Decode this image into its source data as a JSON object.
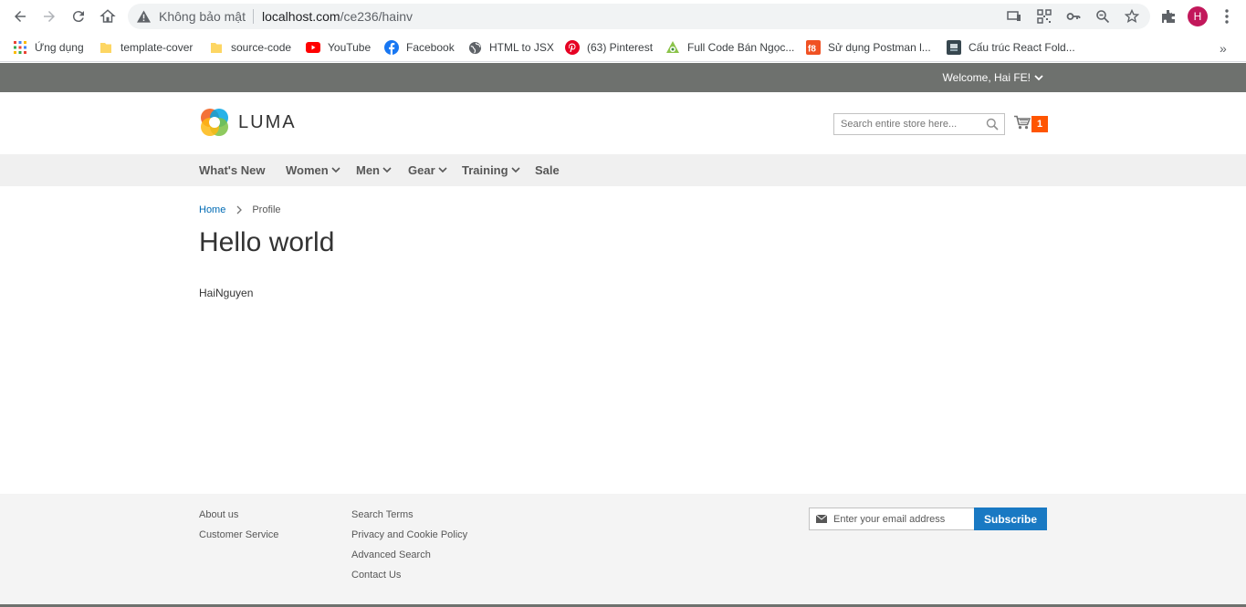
{
  "browser": {
    "security_label": "Không bảo mật",
    "url_host": "localhost.com",
    "url_path": "/ce236/hainv",
    "profile_initial": "H",
    "bookmarks": [
      {
        "label": "Ứng dụng",
        "icon": "apps-grid-icon"
      },
      {
        "label": "template-cover",
        "icon": "folder-icon"
      },
      {
        "label": "source-code",
        "icon": "folder-icon"
      },
      {
        "label": "YouTube",
        "icon": "youtube-icon"
      },
      {
        "label": "Facebook",
        "icon": "facebook-icon"
      },
      {
        "label": "HTML to JSX",
        "icon": "globe-icon"
      },
      {
        "label": "(63) Pinterest",
        "icon": "pinterest-icon"
      },
      {
        "label": "Full Code Bán Ngọc...",
        "icon": "site-icon"
      },
      {
        "label": "Sử dụng Postman l...",
        "icon": "f8-icon"
      },
      {
        "label": "Cấu trúc React Fold...",
        "icon": "site-icon"
      }
    ],
    "more_label": "»"
  },
  "header": {
    "welcome": "Welcome, Hai FE!",
    "logo_text": "LUMA",
    "search_placeholder": "Search entire store here...",
    "cart_count": "1"
  },
  "nav": {
    "items": [
      {
        "label": "What's New",
        "has_dropdown": false
      },
      {
        "label": "Women",
        "has_dropdown": true
      },
      {
        "label": "Men",
        "has_dropdown": true
      },
      {
        "label": "Gear",
        "has_dropdown": true
      },
      {
        "label": "Training",
        "has_dropdown": true
      },
      {
        "label": "Sale",
        "has_dropdown": false
      }
    ]
  },
  "breadcrumbs": {
    "home": "Home",
    "current": "Profile"
  },
  "main": {
    "title": "Hello world",
    "name": "HaiNguyen"
  },
  "footer": {
    "col1": [
      "About us",
      "Customer Service"
    ],
    "col2": [
      "Search Terms",
      "Privacy and Cookie Policy",
      "Advanced Search",
      "Contact Us"
    ],
    "newsletter_placeholder": "Enter your email address",
    "subscribe_label": "Subscribe"
  },
  "colors": {
    "panel_header": "#6e716e",
    "nav_bg": "#f0f0f0",
    "link_blue": "#006bb4",
    "subscribe_blue": "#1979c3",
    "cart_badge": "#ff5501"
  }
}
